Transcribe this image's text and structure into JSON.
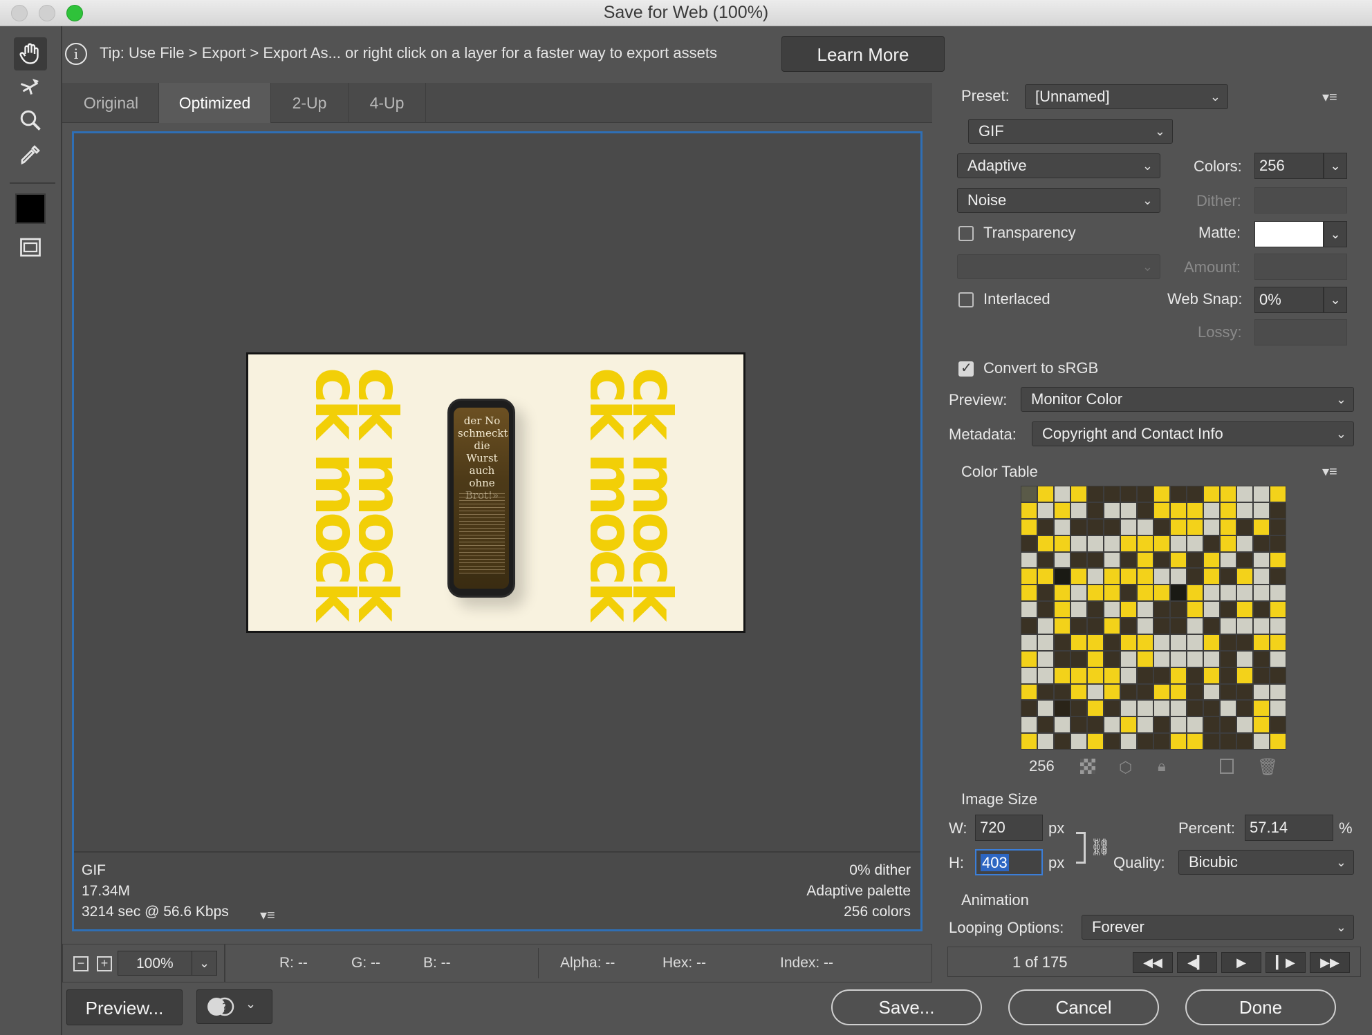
{
  "window": {
    "title": "Save for Web (100%)"
  },
  "tip": {
    "text": "Tip: Use File > Export > Export As...  or right click on a layer for a faster way to export assets",
    "learn_more": "Learn More"
  },
  "tabs": [
    {
      "label": "Original"
    },
    {
      "label": "Optimized"
    },
    {
      "label": "2-Up"
    },
    {
      "label": "4-Up"
    }
  ],
  "canvas": {
    "mock_word": "ck mock",
    "phone_headline": "der No schmeckt die Wurst auch ohne Brot!»",
    "info_left": [
      "GIF",
      "17.34M",
      "3214 sec @ 56.6 Kbps"
    ],
    "info_right": [
      "0% dither",
      "Adaptive palette",
      "256 colors"
    ]
  },
  "status": {
    "zoom": "100%",
    "r": "R: --",
    "g": "G: --",
    "b": "B: --",
    "alpha": "Alpha: --",
    "hex": "Hex: --",
    "index": "Index: --"
  },
  "buttons": {
    "preview": "Preview...",
    "save": "Save...",
    "cancel": "Cancel",
    "done": "Done"
  },
  "settings": {
    "preset_label": "Preset:",
    "preset_value": "[Unnamed]",
    "format": "GIF",
    "palette": "Adaptive",
    "colors_label": "Colors:",
    "colors_value": "256",
    "dither_algo": "Noise",
    "dither_label": "Dither:",
    "transparency_label": "Transparency",
    "matte_label": "Matte:",
    "amount_label": "Amount:",
    "interlaced_label": "Interlaced",
    "websnap_label": "Web Snap:",
    "websnap_value": "0%",
    "lossy_label": "Lossy:",
    "convert_srgb_label": "Convert to sRGB",
    "preview_label": "Preview:",
    "preview_value": "Monitor Color",
    "metadata_label": "Metadata:",
    "metadata_value": "Copyright and Contact Info"
  },
  "color_table": {
    "title": "Color Table",
    "count": "256"
  },
  "image_size": {
    "title": "Image Size",
    "w_label": "W:",
    "w_value": "720",
    "h_label": "H:",
    "h_value": "403",
    "unit": "px",
    "percent_label": "Percent:",
    "percent_value": "57.14",
    "percent_unit": "%",
    "quality_label": "Quality:",
    "quality_value": "Bicubic"
  },
  "animation": {
    "title": "Animation",
    "looping_label": "Looping Options:",
    "looping_value": "Forever",
    "frame_counter": "1 of 175"
  },
  "colors": {
    "accent_blue": "#2f6fb5",
    "mock_yellow": "#f2cf07",
    "bg": "#535353"
  }
}
